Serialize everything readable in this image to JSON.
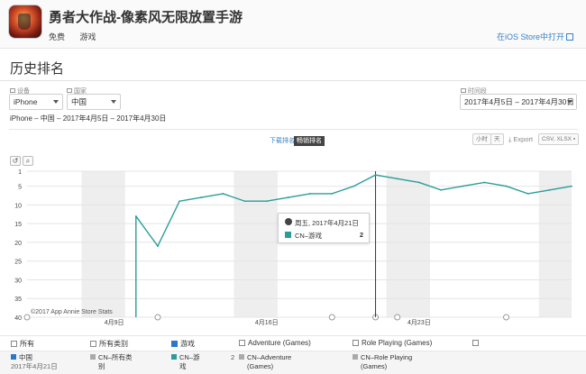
{
  "app": {
    "title": "勇者大作战-像素风无限放置手游",
    "tags": [
      "免费",
      "游戏"
    ],
    "ios_link": "在iOS Store中打开"
  },
  "page": {
    "title": "历史排名",
    "subline": "iPhone – 中国 – 2017年4月5日 – 2017年4月30日"
  },
  "filters": {
    "device_label": "设备",
    "device_value": "iPhone",
    "country_label": "国家",
    "country_value": "中国",
    "range_label": "时间段",
    "range_value": "2017年4月5日 – 2017年4月30日"
  },
  "chart_toolbar": {
    "mode_off": "下载排名",
    "mode_on": "畅销排名",
    "hour": "小时",
    "day": "天",
    "export": "Export",
    "format": "CSV, XLSX"
  },
  "tooltip": {
    "date": "周五, 2017年4月21日",
    "series": "CN–游戏",
    "value": "2"
  },
  "copyright": "©2017 App Annie Store Stats",
  "legend": {
    "checkboxes": [
      {
        "label": "所有",
        "checked": false
      },
      {
        "label": "所有类别",
        "checked": false
      },
      {
        "label": "游戏",
        "checked": true
      },
      {
        "label": "Adventure (Games)",
        "checked": false
      },
      {
        "label": "Role Playing (Games)",
        "checked": false
      }
    ],
    "region": "中国",
    "region_date": "2017年4月21日",
    "entries": [
      {
        "line1": "CN–所有类",
        "line2": "别",
        "value": ""
      },
      {
        "line1": "CN–游",
        "line2": "戏",
        "value": "2"
      },
      {
        "line1": "CN–Adventure",
        "line2": "(Games)",
        "value": ""
      },
      {
        "line1": "CN–Role Playing",
        "line2": "(Games)",
        "value": ""
      }
    ]
  },
  "colors": {
    "series": "#2a9d9a",
    "weekend_band": "#eeeeee",
    "grid": "#e4e4e4",
    "crosshair": "#333333",
    "checkbox_checked": "#2b78c6"
  },
  "chart_data": {
    "type": "line",
    "series": [
      {
        "name": "CN–游戏",
        "x": [
          "2017-04-05",
          "2017-04-06",
          "2017-04-07",
          "2017-04-08",
          "2017-04-09",
          "2017-04-10",
          "2017-04-11",
          "2017-04-12",
          "2017-04-13",
          "2017-04-14",
          "2017-04-15",
          "2017-04-16",
          "2017-04-17",
          "2017-04-18",
          "2017-04-19",
          "2017-04-20",
          "2017-04-21",
          "2017-04-22",
          "2017-04-23",
          "2017-04-24",
          "2017-04-25",
          "2017-04-26",
          "2017-04-27",
          "2017-04-28",
          "2017-04-29",
          "2017-04-30"
        ],
        "values": [
          null,
          null,
          null,
          null,
          null,
          13,
          21,
          9,
          8,
          7,
          9,
          9,
          8,
          7,
          7,
          5,
          2,
          3,
          4,
          6,
          5,
          4,
          5,
          7,
          6,
          5
        ]
      }
    ],
    "y_ticks": [
      1,
      5,
      10,
      15,
      20,
      25,
      30,
      35,
      40
    ],
    "ylim": [
      40,
      1
    ],
    "y_reversed": true,
    "x_tick_labels": [
      {
        "date": "2017-04-09",
        "label": "4月9日"
      },
      {
        "date": "2017-04-16",
        "label": "4月16日"
      },
      {
        "date": "2017-04-23",
        "label": "4月23日"
      }
    ],
    "weekend_bands": [
      [
        "2017-04-08",
        "2017-04-09"
      ],
      [
        "2017-04-15",
        "2017-04-16"
      ],
      [
        "2017-04-22",
        "2017-04-23"
      ],
      [
        "2017-04-29",
        "2017-04-30"
      ]
    ],
    "xlim": [
      "2017-04-05",
      "2017-04-30"
    ],
    "crosshair_date": "2017-04-21",
    "grid": true,
    "legend": "bottom"
  }
}
